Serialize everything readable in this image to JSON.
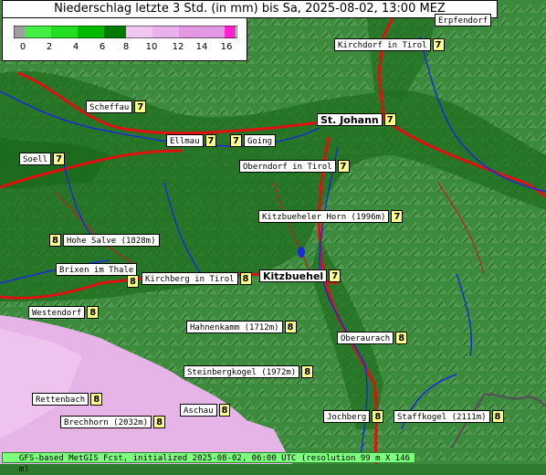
{
  "title": "Niederschlag letzte 3 Std. (in mm) bis Sa, 2025-08-02, 13:00 MEZ",
  "legend": {
    "ticks": [
      "0",
      "2",
      "4",
      "6",
      "8",
      "10",
      "12",
      "14",
      "16"
    ],
    "colors": [
      "#a0a0a0",
      "#44ee44",
      "#00cc00",
      "#009900",
      "#006600",
      "#f0b8f0",
      "#e890e8",
      "#dd66dd",
      "#ff22cc"
    ]
  },
  "footer": "GFS-based MetGIS Fcst, initialized 2025-08-02, 06:00 UTC  (resolution 99 m X 146 m)",
  "places": [
    {
      "name": "Erpfendorf",
      "value": ""
    },
    {
      "name": "Kirchdorf in Tirol",
      "value": "7"
    },
    {
      "name": "Scheffau",
      "value": "7"
    },
    {
      "name": "St. Johann",
      "value": "7"
    },
    {
      "name": "Ellmau",
      "value": "7"
    },
    {
      "name": "Going",
      "value": "7"
    },
    {
      "name": "Soell",
      "value": "7"
    },
    {
      "name": "Oberndorf in Tirol",
      "value": "7"
    },
    {
      "name": "Kitzbueheler Horn (1996m)",
      "value": "7"
    },
    {
      "name": "Hohe Salve (1828m)",
      "value": "8"
    },
    {
      "name": "Brixen im Thale",
      "value": "8"
    },
    {
      "name": "Kirchberg in Tirol",
      "value": "8"
    },
    {
      "name": "Kitzbuehel",
      "value": "7"
    },
    {
      "name": "Westendorf",
      "value": "8"
    },
    {
      "name": "Hahnenkamm (1712m)",
      "value": "8"
    },
    {
      "name": "Oberaurach",
      "value": "8"
    },
    {
      "name": "Steinbergkogel (1972m)",
      "value": "8"
    },
    {
      "name": "Rettenbach",
      "value": "8"
    },
    {
      "name": "Aschau",
      "value": "8"
    },
    {
      "name": "Brechhorn (2032m)",
      "value": "8"
    },
    {
      "name": "Jochberg",
      "value": "8"
    },
    {
      "name": "Staffkogel (2111m)",
      "value": "8"
    }
  ]
}
